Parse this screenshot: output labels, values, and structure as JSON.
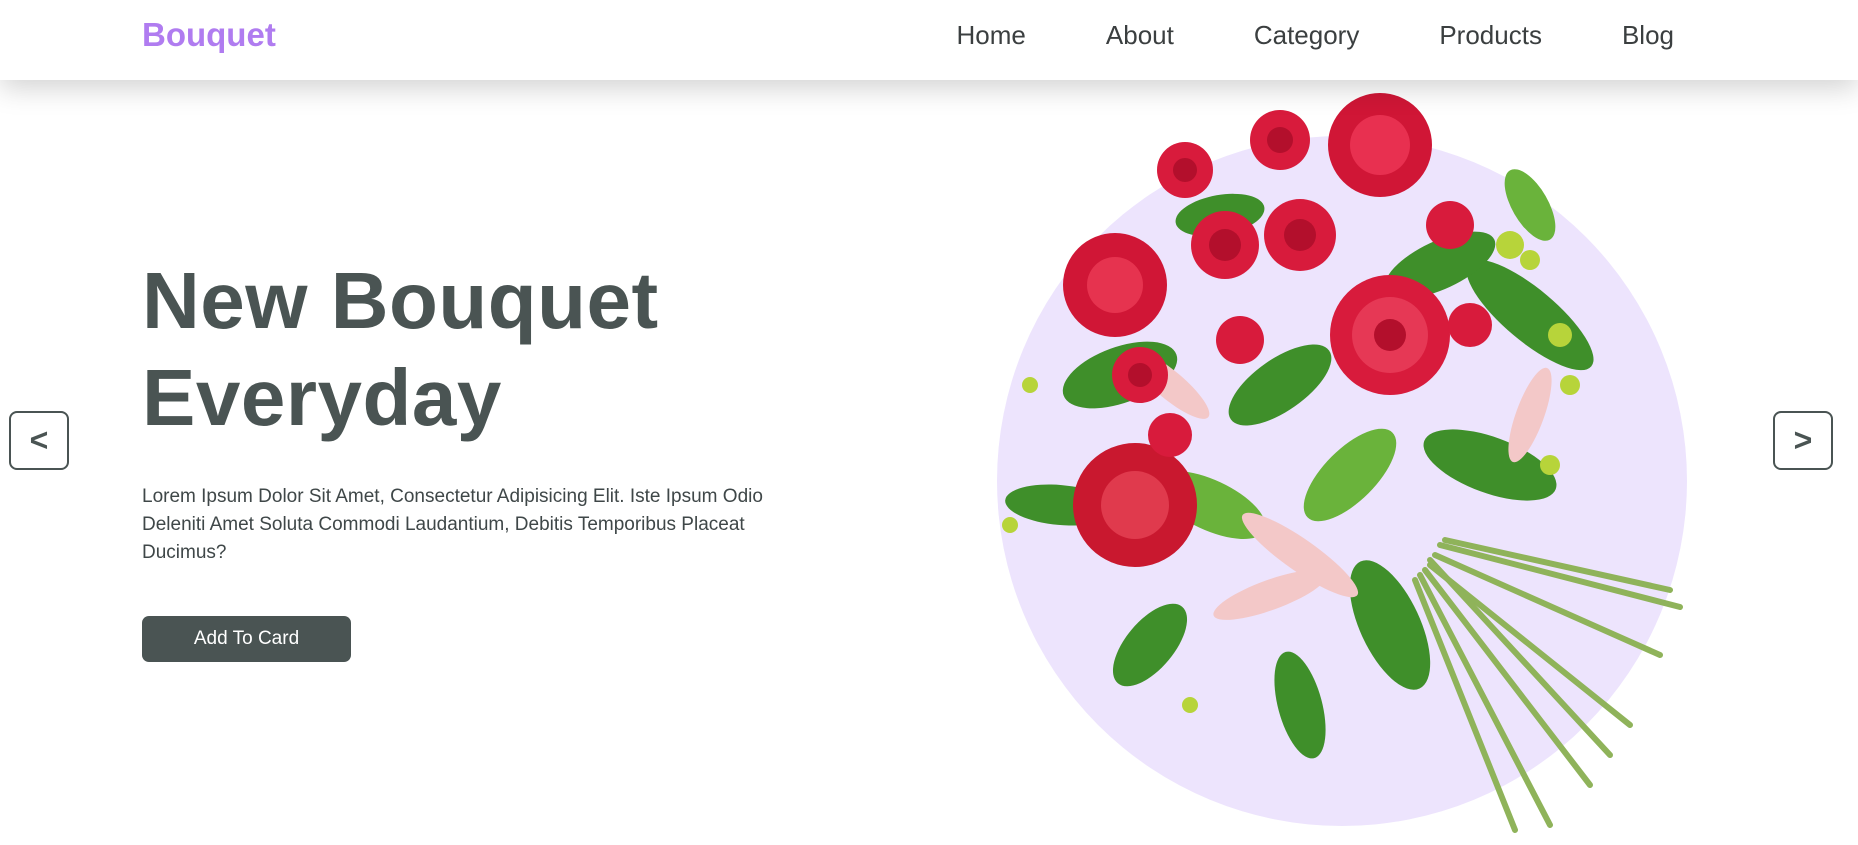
{
  "brand": {
    "name": "Bouquet",
    "accent": "#b07cf0"
  },
  "nav": {
    "items": [
      {
        "label": "Home"
      },
      {
        "label": "About"
      },
      {
        "label": "Category"
      },
      {
        "label": "Products"
      },
      {
        "label": "Blog"
      }
    ]
  },
  "hero": {
    "title_line1": "New Bouquet",
    "title_line2": "Everyday",
    "description": "Lorem Ipsum Dolor Sit Amet, Consectetur Adipisicing Elit. Iste Ipsum Odio Deleniti Amet Soluta Commodi Laudantium, Debitis Temporibus Placeat Ducimus?",
    "cta_label": "Add To Card",
    "text_color": "#4a5453",
    "circle_color": "#ede4fd"
  },
  "slider": {
    "prev_label": "<",
    "next_label": ">"
  },
  "icons": {
    "prev": "chevron-left-icon",
    "next": "chevron-right-icon",
    "hero_image": "flower-bouquet-illustration"
  }
}
